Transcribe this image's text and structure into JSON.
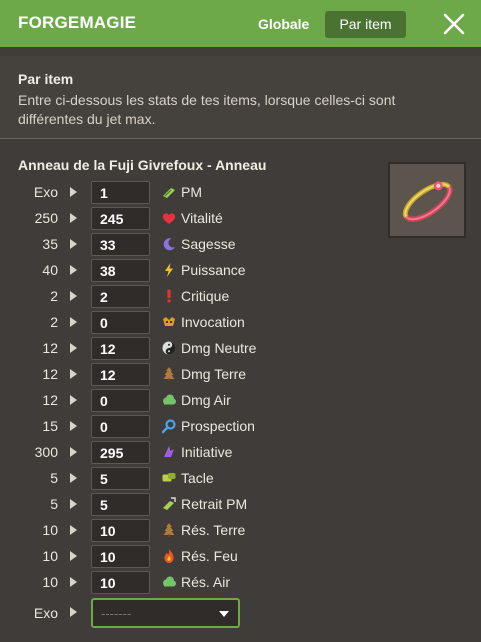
{
  "header": {
    "title": "FORGEMAGIE",
    "tab_globale": "Globale",
    "tab_par_item": "Par item",
    "accent": "#6da948"
  },
  "intro": {
    "title": "Par item",
    "description": "Entre ci-dessous les stats de tes items, lorsque celles-ci sont différentes du jet max."
  },
  "item": {
    "name": "Anneau de la Fuji Givrefoux - Anneau",
    "icon": "ring-icon"
  },
  "stats": [
    {
      "max": "Exo",
      "value": "1",
      "name": "PM",
      "icon": "pm-boots-icon"
    },
    {
      "max": "250",
      "value": "245",
      "name": "Vitalité",
      "icon": "heart-icon"
    },
    {
      "max": "35",
      "value": "33",
      "name": "Sagesse",
      "icon": "moon-icon"
    },
    {
      "max": "40",
      "value": "38",
      "name": "Puissance",
      "icon": "lightning-icon"
    },
    {
      "max": "2",
      "value": "2",
      "name": "Critique",
      "icon": "exclamation-icon"
    },
    {
      "max": "2",
      "value": "0",
      "name": "Invocation",
      "icon": "summon-icon"
    },
    {
      "max": "12",
      "value": "12",
      "name": "Dmg Neutre",
      "icon": "neutral-yinyang-icon"
    },
    {
      "max": "12",
      "value": "12",
      "name": "Dmg Terre",
      "icon": "earth-tree-icon"
    },
    {
      "max": "12",
      "value": "0",
      "name": "Dmg Air",
      "icon": "air-cloud-icon"
    },
    {
      "max": "15",
      "value": "0",
      "name": "Prospection",
      "icon": "magnifier-icon"
    },
    {
      "max": "300",
      "value": "295",
      "name": "Initiative",
      "icon": "initiative-icon"
    },
    {
      "max": "5",
      "value": "5",
      "name": "Tacle",
      "icon": "tackle-icon"
    },
    {
      "max": "5",
      "value": "5",
      "name": "Retrait PM",
      "icon": "pm-removal-icon"
    },
    {
      "max": "10",
      "value": "10",
      "name": "Rés. Terre",
      "icon": "earth-tree-icon"
    },
    {
      "max": "10",
      "value": "10",
      "name": "Rés. Feu",
      "icon": "fire-icon"
    },
    {
      "max": "10",
      "value": "10",
      "name": "Rés. Air",
      "icon": "air-cloud-icon"
    }
  ],
  "exo": {
    "label": "Exo",
    "selected": "-------"
  }
}
